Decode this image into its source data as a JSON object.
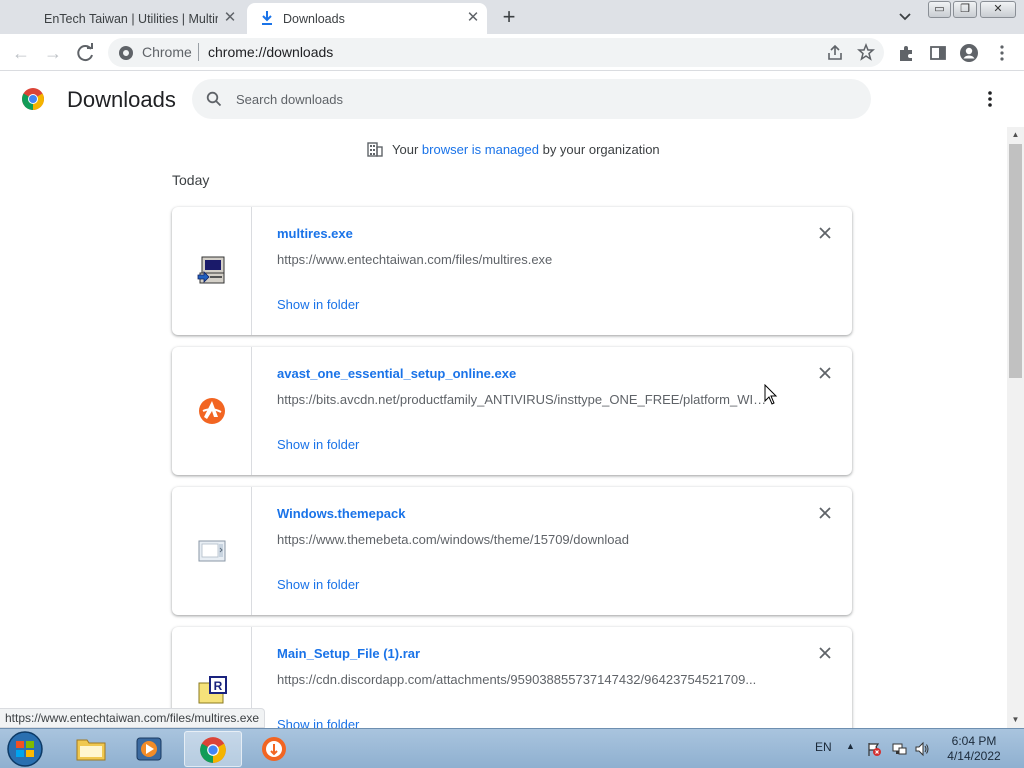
{
  "tabs": [
    {
      "title": "EnTech Taiwan | Utilities | Multire",
      "active": false
    },
    {
      "title": "Downloads",
      "active": true
    }
  ],
  "window_controls": {
    "minimize": "▭",
    "restore": "❐",
    "close": "✕"
  },
  "toolbar": {
    "site_label": "Chrome",
    "url": "chrome://downloads"
  },
  "page": {
    "title": "Downloads",
    "search_placeholder": "Search downloads"
  },
  "managed_notice": {
    "prefix": "Your",
    "link": "browser is managed",
    "suffix": "by your organization"
  },
  "section_label": "Today",
  "downloads": [
    {
      "name": "multires.exe",
      "url": "https://www.entechtaiwan.com/files/multires.exe",
      "action": "Show in folder",
      "icon": "exe-program-icon"
    },
    {
      "name": "avast_one_essential_setup_online.exe",
      "url": "https://bits.avcdn.net/productfamily_ANTIVIRUS/insttype_ONE_FREE/platform_WIN...",
      "action": "Show in folder",
      "icon": "avast-icon"
    },
    {
      "name": "Windows.themepack",
      "url": "https://www.themebeta.com/windows/theme/15709/download",
      "action": "Show in folder",
      "icon": "themepack-icon"
    },
    {
      "name": "Main_Setup_File (1).rar",
      "url": "https://cdn.discordapp.com/attachments/959038855737147432/96423754521709...",
      "action": "Show in folder",
      "icon": "rar-archive-icon"
    }
  ],
  "status_bubble": "https://www.entechtaiwan.com/files/multires.exe",
  "taskbar": {
    "language": "EN",
    "time": "6:04 PM",
    "date": "4/14/2022"
  },
  "colors": {
    "accent": "#1a73e8",
    "tabstrip": "#dee1e6",
    "omnibox": "#f1f3f4",
    "avast": "#f26522"
  }
}
